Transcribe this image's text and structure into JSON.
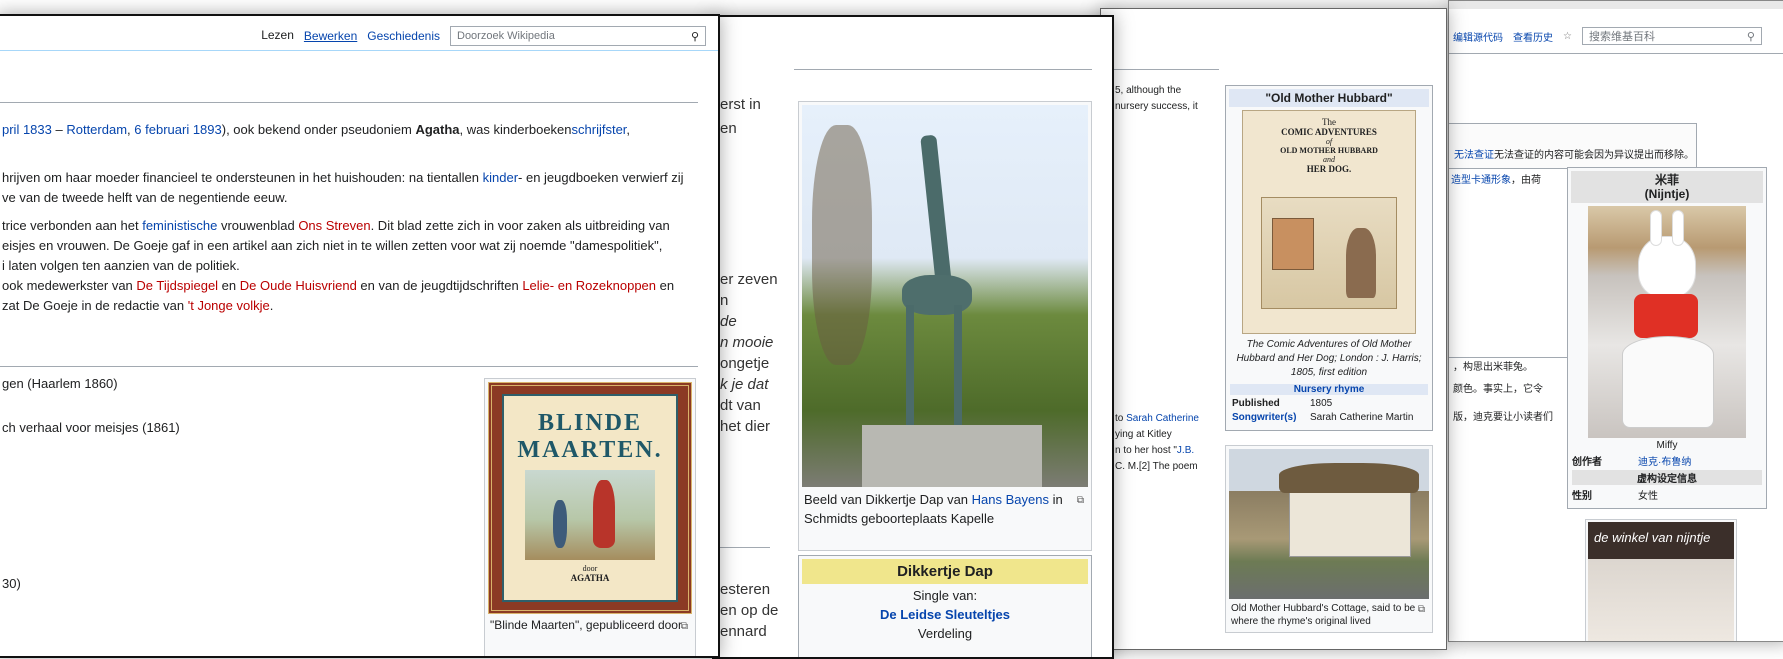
{
  "w4": {
    "tabs": [
      "编辑源代码",
      "查看历史"
    ],
    "star": "☆",
    "search_placeholder": "搜索维基百科",
    "notice": "无法查证的内容可能会因为异议提出而移除。",
    "notice_link": "无法查证",
    "text1_link": "卡通形象",
    "text1_pre": "造型",
    "text1_post": "，由荷",
    "line_a": "，构思出米菲兔。",
    "line_b": "颜色。事实上，它令",
    "line_c": "版，迪克要让小读者们",
    "infobox": {
      "title": "米菲",
      "subtitle": "(Nijntje)",
      "image_caption": "Miffy",
      "rows": [
        {
          "label": "创作者",
          "value": "迪克·布鲁纳"
        }
      ],
      "section": "虚构设定信息",
      "rows2": [
        {
          "label": "性别",
          "value": "女性"
        }
      ]
    },
    "shop_sign": "de winkel van nijntje"
  },
  "w3": {
    "text_top": [
      "5, although the",
      "nursery success, it"
    ],
    "infobox": {
      "title": "\"Old Mother Hubbard\"",
      "cover_lines": [
        "The",
        "COMIC ADVENTURES",
        "of",
        "OLD MOTHER HUBBARD",
        "and",
        "HER DOG."
      ],
      "caption": "The Comic Adventures of Old Mother Hubbard and Her Dog; London : J. Harris; 1805, first edition",
      "section": "Nursery rhyme",
      "rows": [
        {
          "label": "Published",
          "value": "1805"
        },
        {
          "label": "Songwriter(s)",
          "value": "Sarah Catherine Martin"
        }
      ]
    },
    "lines_mid": [
      "to Sarah Catherine",
      "ying at Kitley",
      "n to her host \"J.B.",
      "C. M.[2] The poem"
    ],
    "link_sarah": "Sarah Catherine",
    "link_jb": "J.B.",
    "cottage_caption": "Old Mother Hubbard's Cottage, said to be where the rhyme's original lived"
  },
  "w2": {
    "left_text_top": [
      "erst in",
      "en"
    ],
    "left_text_mid": [
      "er zeven",
      "n",
      "de",
      "n mooie",
      "ongetje",
      "k je dat",
      "dt van",
      "het dier"
    ],
    "left_text_bottom": [
      "esteren",
      "en op de",
      "ennard"
    ],
    "photo_caption_pre": "Beeld van Dikkertje Dap van ",
    "photo_caption_link": "Hans Bayens",
    "photo_caption_post": " in Schmidts geboorteplaats Kapelle",
    "infobox_title": "Dikkertje Dap",
    "infobox_sub": "Single van:",
    "infobox_artist": "De Leidse Sleuteltjes",
    "infobox_cut": "Verdeling"
  },
  "w1": {
    "tabs": [
      {
        "label": "Lezen",
        "active": true
      },
      {
        "label": "Bewerken",
        "active": false
      },
      {
        "label": "Geschiedenis",
        "active": false
      }
    ],
    "search_placeholder": "Doorzoek Wikipedia",
    "para1": {
      "a": "pril 1833",
      "b": " – ",
      "c": "Rotterdam",
      "d": ", ",
      "e": "6 februari",
      "f": " ",
      "g": "1893",
      "h": "), ook bekend onder pseudoniem ",
      "bold": "Agatha",
      "i": ", was kinderboeken",
      "j": "schrijfster",
      "k": ","
    },
    "para2": [
      "hrijven om haar moeder financieel te ondersteunen in het huishouden: na tientallen ",
      "kinder",
      "- en jeugdboeken verwierf zij",
      "ve van de tweede helft van de negentiende eeuw."
    ],
    "para3_l1": [
      "trice verbonden aan het ",
      "feministische",
      " vrouwenblad ",
      "Ons Streven",
      ". Dit blad zette zich in voor zaken als uitbreiding van"
    ],
    "para3_l2": "eisjes en vrouwen. De Goeje gaf in een artikel aan zich niet in te willen zetten voor wat zij noemde \"damespolitiek\",",
    "para3_l3": "i laten volgen ten aanzien van de politiek.",
    "para3_l4": [
      "ook medewerkster van ",
      "De Tijdspiegel",
      " en ",
      "De Oude Huisvriend",
      " en van de jeugdtijdschriften ",
      "Lelie- en Rozeknoppen",
      " en"
    ],
    "para3_l5": [
      "zat De Goeje in de redactie van ",
      "'t Jonge volkje",
      "."
    ],
    "list": [
      "gen (Haarlem 1860)",
      "ch verhaal voor meisjes (1861)",
      "30)"
    ],
    "book": {
      "title1": "BLINDE",
      "title2": "MAARTEN.",
      "door": "door",
      "author": "AGATHA"
    },
    "book_caption": "\"Blinde Maarten\", gepubliceerd door"
  }
}
